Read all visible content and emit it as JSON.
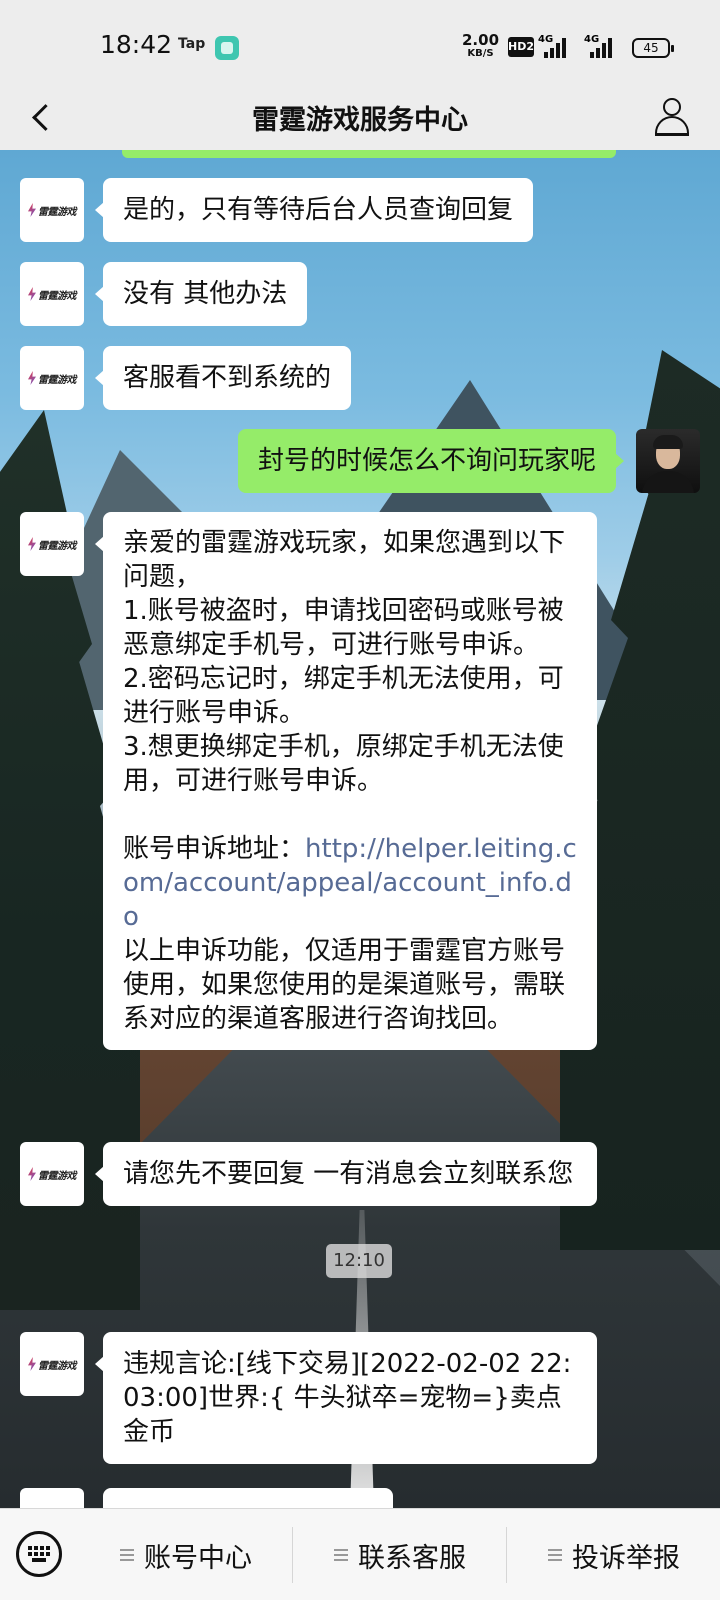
{
  "status_bar": {
    "time": "18:42",
    "tap_label": "Tap",
    "net_speed_value": "2.00",
    "net_speed_unit": "KB/S",
    "hd_label": "HD2",
    "signal1_label": "4G",
    "signal2_label": "4G",
    "battery": "45"
  },
  "header": {
    "title": "雷霆游戏服务中心"
  },
  "brand": {
    "logo_text": "雷霆游戏",
    "accent_green": "#95ec69",
    "link_color": "#576b95"
  },
  "messages": [
    {
      "from": "service",
      "text": "是的，只有等待后台人员查询回复"
    },
    {
      "from": "service",
      "text": "没有 其他办法"
    },
    {
      "from": "service",
      "text": "客服看不到系统的"
    },
    {
      "from": "user",
      "text": "封号的时候怎么不询问玩家呢"
    },
    {
      "from": "service",
      "text_before_link": "亲爱的雷霆游戏玩家，如果您遇到以下问题，\n1.账号被盗时，申请找回密码或账号被恶意绑定手机号，可进行账号申诉。\n2.密码忘记时，绑定手机无法使用，可进行账号申诉。\n3.想更换绑定手机，原绑定手机无法使用，可进行账号申诉。\n\n账号申诉地址：",
      "link": "http://helper.leiting.com/account/appeal/account_info.do",
      "text_after_link": "以上申诉功能，仅适用于雷霆官方账号使用，如果您使用的是渠道账号，需联系对应的渠道客服进行咨询找回。"
    },
    {
      "from": "service",
      "text": "请您先不要回复 一有消息会立刻联系您"
    },
    {
      "from": "service",
      "text": "违规言论:[线下交易][2022-02-02 22:03:00]世界:{ 牛头狱卒=宠物=}卖点金币"
    }
  ],
  "timestamp": "12:10",
  "bottom_menu": {
    "items": [
      "账号中心",
      "联系客服",
      "投诉举报"
    ]
  }
}
